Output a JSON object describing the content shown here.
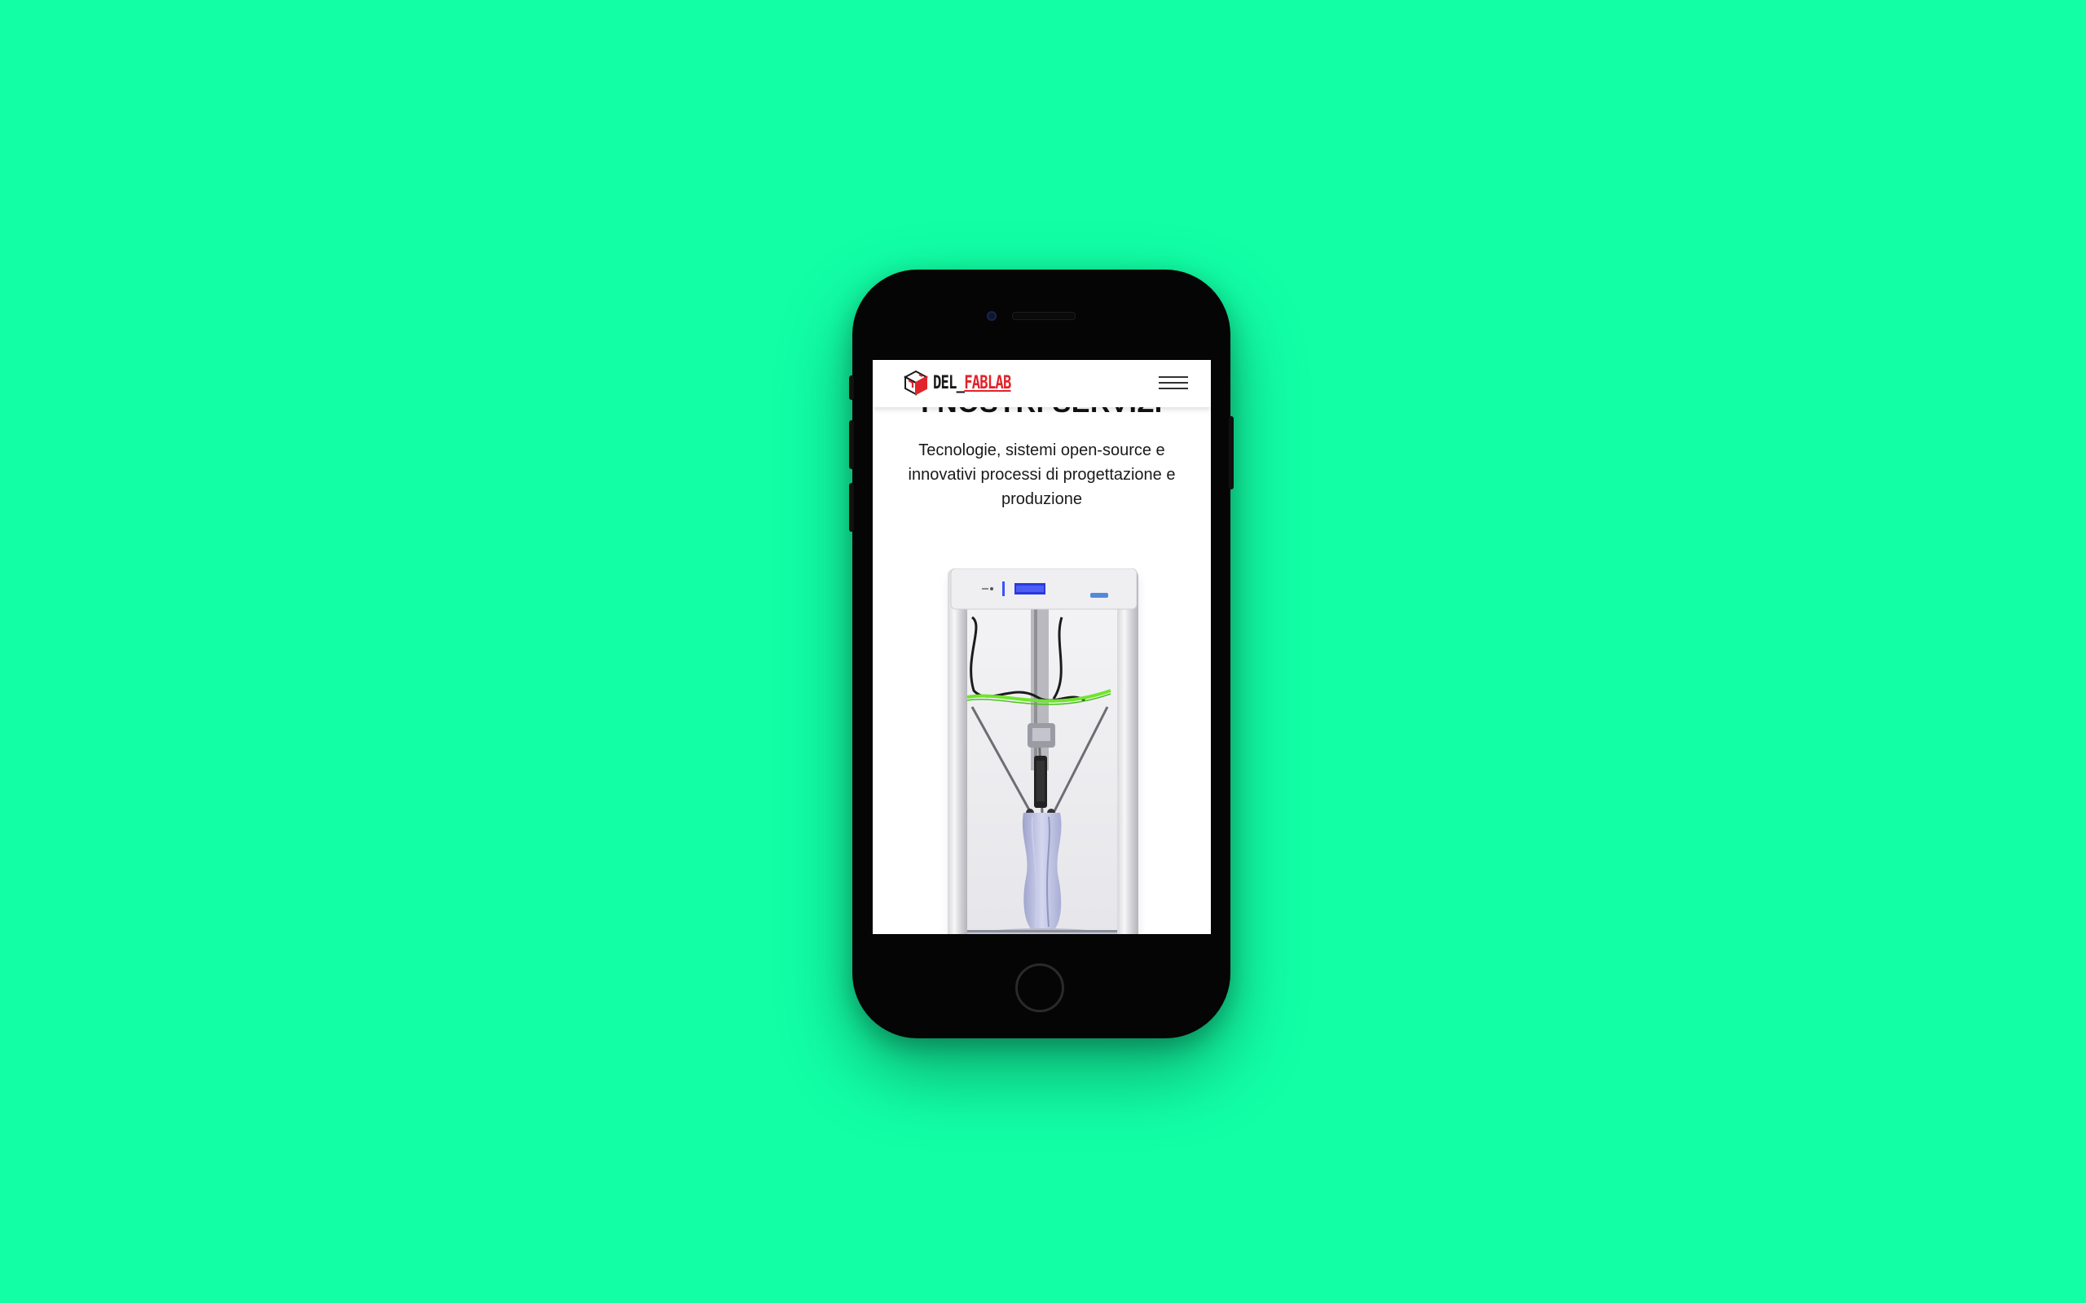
{
  "brand": {
    "logo_prefix": "DEL_",
    "logo_suffix": "FABLAB",
    "accent": "#e1232b"
  },
  "header": {
    "menu_icon": "hamburger-menu-icon"
  },
  "content": {
    "section_title": "I NOSTRI SERVIZI",
    "subtitle": "Tecnologie, sistemi open-source e innovativi processi di progettazione e produzione",
    "hero_image": "3d-printer-image"
  },
  "colors": {
    "background": "#12ffa6",
    "phone_body": "#050505",
    "screen": "#ffffff",
    "filament_green": "#6fe52c",
    "print_vase": "#b9bedf"
  }
}
